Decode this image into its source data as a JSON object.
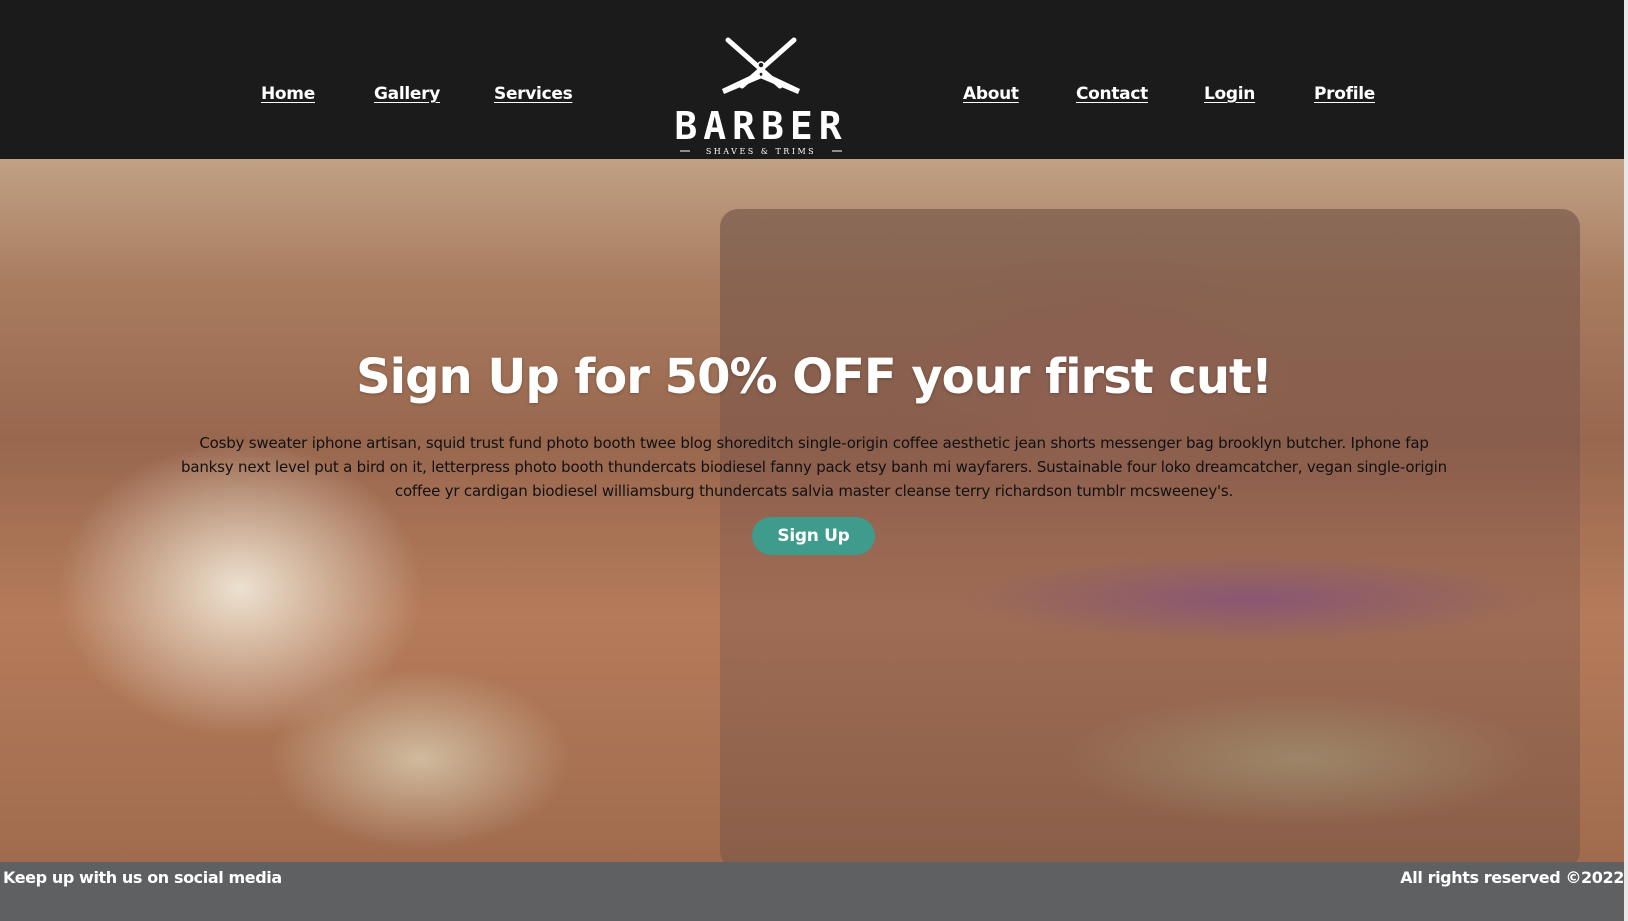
{
  "nav": {
    "left": [
      {
        "label": "Home"
      },
      {
        "label": "Gallery"
      },
      {
        "label": "Services"
      }
    ],
    "right": [
      {
        "label": "About"
      },
      {
        "label": "Contact"
      },
      {
        "label": "Login"
      },
      {
        "label": "Profile"
      }
    ]
  },
  "logo": {
    "title": "BARBER",
    "tagline": "SHAVES & TRIMS",
    "icon": "crossed-razors-icon"
  },
  "hero": {
    "headline": "Sign Up for 50% OFF your first cut!",
    "blurb": "Cosby sweater iphone artisan, squid trust fund photo booth twee blog shoreditch single-origin coffee aesthetic jean shorts messenger bag brooklyn butcher. Iphone fap banksy next level put a bird on it, letterpress photo booth thundercats biodiesel fanny pack etsy banh mi wayfarers. Sustainable four loko dreamcatcher, vegan single-origin coffee yr cardigan biodiesel williamsburg thundercats salvia master cleanse terry richardson tumblr mcsweeney's.",
    "button_label": "Sign Up"
  },
  "footer": {
    "left_text": "Keep up with us on social media",
    "right_text": "All rights reserved ©2022"
  },
  "colors": {
    "header_bg": "#1b1b1b",
    "button_bg": "#3f9b8c",
    "footer_bg": "#5f6062"
  }
}
